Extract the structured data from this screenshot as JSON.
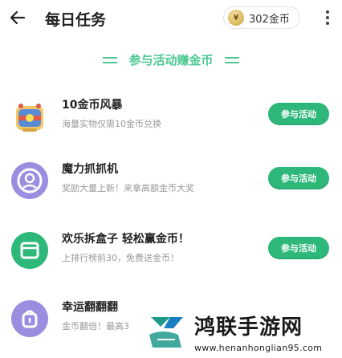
{
  "header": {
    "title": "每日任务",
    "coin_balance": "302金币",
    "icons": {
      "back": "arrow-left-icon",
      "coin": "coin-icon",
      "more": "more-vertical-icon"
    }
  },
  "section": {
    "title": "参与活动赚金币"
  },
  "tasks": [
    {
      "title": "10金币风暴",
      "desc": "海量实物仅需10金币兑换",
      "button": "参与活动",
      "icon": "treasure-chest-icon"
    },
    {
      "title": "魔力抓抓机",
      "desc": "奖励大量上新！来拿高额金币大奖",
      "button": "参与活动",
      "icon": "claw-machine-icon"
    },
    {
      "title": "欢乐拆盒子 轻松赢金币！",
      "desc": "上排行榜前30，免费送金币！",
      "button": "参与活动",
      "icon": "gift-box-icon"
    },
    {
      "title": "幸运翻翻翻",
      "desc": "金币翻倍！最高3",
      "button": "",
      "icon": "lucky-bag-icon"
    }
  ],
  "watermark": {
    "brand": "鸿联手游网",
    "url": "www.henanhonglian95.com"
  },
  "colors": {
    "accent": "#4cc990",
    "button": "#2db87a",
    "icon_purple": "#9b8ee0"
  }
}
